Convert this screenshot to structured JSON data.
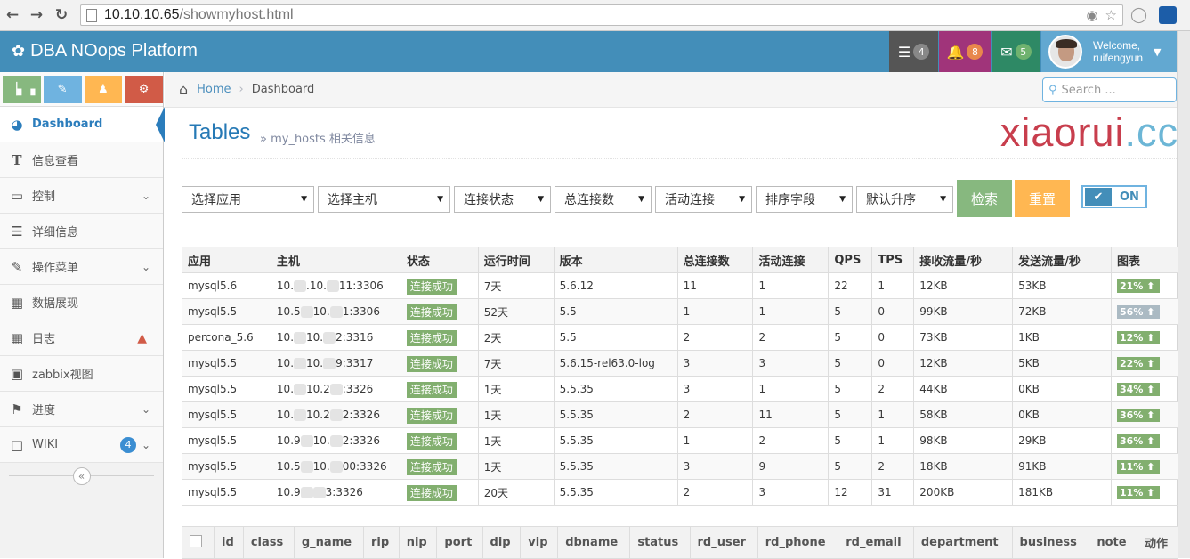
{
  "browser": {
    "url_host": "10.10.10.65",
    "url_path": "/showmyhost.html"
  },
  "navbar": {
    "brand": "DBA NOops Platform",
    "tasks_count": "4",
    "notifications_count": "8",
    "messages_count": "5",
    "welcome_label": "Welcome,",
    "username": "ruifengyun"
  },
  "sidebar": {
    "items": [
      {
        "label": "Dashboard",
        "icon": "dashboard-icon"
      },
      {
        "label": "信息查看",
        "icon": "text-icon"
      },
      {
        "label": "控制",
        "icon": "desktop-icon"
      },
      {
        "label": "详细信息",
        "icon": "list-icon"
      },
      {
        "label": "操作菜单",
        "icon": "edit-icon"
      },
      {
        "label": "数据展现",
        "icon": "table-icon"
      },
      {
        "label": "日志",
        "icon": "calendar-icon"
      },
      {
        "label": "zabbix视图",
        "icon": "picture-icon"
      },
      {
        "label": "进度",
        "icon": "tag-icon"
      },
      {
        "label": "WIKI",
        "icon": "file-icon",
        "badge": "4"
      }
    ]
  },
  "breadcrumb": {
    "home": "Home",
    "current": "Dashboard",
    "search_placeholder": "Search ..."
  },
  "header": {
    "title": "Tables",
    "subtitle": "» my_hosts 相关信息",
    "logo_main": "xiaorui",
    "logo_dot": ".cc"
  },
  "filters": {
    "app": "选择应用",
    "host": "选择主机",
    "conn_status": "连接状态",
    "total_conn": "总连接数",
    "active_conn": "活动连接",
    "sort_field": "排序字段",
    "sort_order": "默认升序",
    "search_btn": "检索",
    "reset_btn": "重置",
    "toggle_label": "ON"
  },
  "hosts_table": {
    "headers": [
      "应用",
      "主机",
      "状态",
      "运行时间",
      "版本",
      "总连接数",
      "活动连接",
      "QPS",
      "TPS",
      "接收流量/秒",
      "发送流量/秒",
      "图表"
    ],
    "rows": [
      {
        "app": "mysql5.6",
        "host_a": "10.",
        "host_b": ".10.",
        "host_c": "11:3306",
        "status": "连接成功",
        "uptime": "7天",
        "version": "5.6.12",
        "total": "11",
        "active": "1",
        "qps": "22",
        "tps": "1",
        "recv": "12KB",
        "send": "53KB",
        "chart": "21%",
        "chart_color": "#82af6f"
      },
      {
        "app": "mysql5.5",
        "host_a": "10.5",
        "host_b": "10.",
        "host_c": "1:3306",
        "status": "连接成功",
        "uptime": "52天",
        "version": "5.5",
        "total": "1",
        "active": "1",
        "qps": "5",
        "tps": "0",
        "recv": "99KB",
        "send": "72KB",
        "chart": "56%",
        "chart_color": "#abbac3"
      },
      {
        "app": "percona_5.6",
        "host_a": "10.",
        "host_b": "10.",
        "host_c": "2:3316",
        "status": "连接成功",
        "uptime": "2天",
        "version": "5.5",
        "total": "2",
        "active": "2",
        "qps": "5",
        "tps": "0",
        "recv": "73KB",
        "send": "1KB",
        "chart": "12%",
        "chart_color": "#82af6f"
      },
      {
        "app": "mysql5.5",
        "host_a": "10.",
        "host_b": "10.",
        "host_c": "9:3317",
        "status": "连接成功",
        "uptime": "7天",
        "version": "5.6.15-rel63.0-log",
        "total": "3",
        "active": "3",
        "qps": "5",
        "tps": "0",
        "recv": "12KB",
        "send": "5KB",
        "chart": "22%",
        "chart_color": "#82af6f"
      },
      {
        "app": "mysql5.5",
        "host_a": "10.",
        "host_b": "10.2",
        "host_c": ":3326",
        "status": "连接成功",
        "uptime": "1天",
        "version": "5.5.35",
        "total": "3",
        "active": "1",
        "qps": "5",
        "tps": "2",
        "recv": "44KB",
        "send": "0KB",
        "chart": "34%",
        "chart_color": "#82af6f"
      },
      {
        "app": "mysql5.5",
        "host_a": "10.",
        "host_b": "10.2",
        "host_c": "2:3326",
        "status": "连接成功",
        "uptime": "1天",
        "version": "5.5.35",
        "total": "2",
        "active": "11",
        "qps": "5",
        "tps": "1",
        "recv": "58KB",
        "send": "0KB",
        "chart": "36%",
        "chart_color": "#82af6f"
      },
      {
        "app": "mysql5.5",
        "host_a": "10.9",
        "host_b": "10.",
        "host_c": "2:3326",
        "status": "连接成功",
        "uptime": "1天",
        "version": "5.5.35",
        "total": "1",
        "active": "2",
        "qps": "5",
        "tps": "1",
        "recv": "98KB",
        "send": "29KB",
        "chart": "36%",
        "chart_color": "#82af6f"
      },
      {
        "app": "mysql5.5",
        "host_a": "10.5",
        "host_b": "10.",
        "host_c": "00:3326",
        "status": "连接成功",
        "uptime": "1天",
        "version": "5.5.35",
        "total": "3",
        "active": "9",
        "qps": "5",
        "tps": "2",
        "recv": "18KB",
        "send": "91KB",
        "chart": "11%",
        "chart_color": "#82af6f"
      },
      {
        "app": "mysql5.5",
        "host_a": "10.9",
        "host_b": "",
        "host_c": "3:3326",
        "status": "连接成功",
        "uptime": "20天",
        "version": "5.5.35",
        "total": "2",
        "active": "3",
        "qps": "12",
        "tps": "31",
        "recv": "200KB",
        "send": "181KB",
        "chart": "11%",
        "chart_color": "#82af6f"
      }
    ]
  },
  "detail_table": {
    "headers": [
      "id",
      "class",
      "g_name",
      "rip",
      "nip",
      "port",
      "dip",
      "vip",
      "dbname",
      "status",
      "rd_user",
      "rd_phone",
      "rd_email",
      "department",
      "business",
      "note",
      "动作"
    ]
  }
}
